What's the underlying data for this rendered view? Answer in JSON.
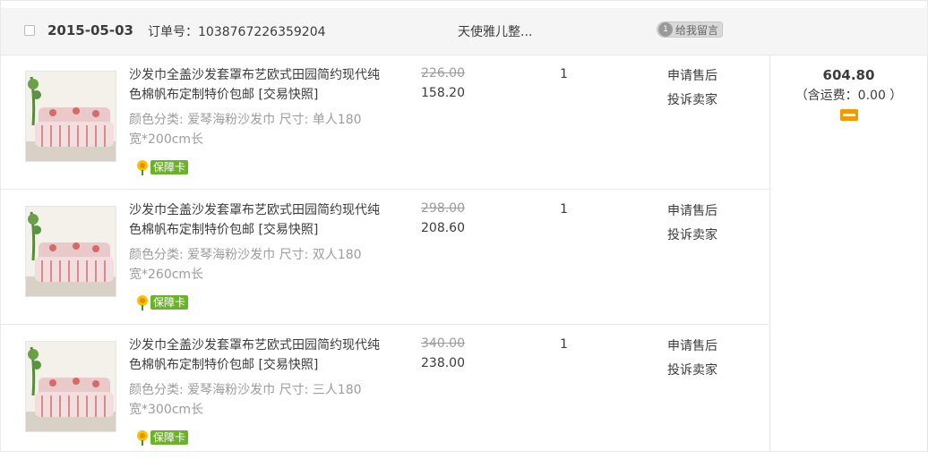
{
  "order": {
    "date": "2015-05-03",
    "order_no_label": "订单号：1038767226359204",
    "shop_name": "天使雅儿整...",
    "message_badge": "1",
    "message_label": "给我留言",
    "total": "604.80",
    "shipping_text": "（含运费：0.00 ）"
  },
  "items": [
    {
      "title": "沙发巾全盖沙发套罩布艺欧式田园简约现代纯色棉帆布定制特价包邮 [交易快照]",
      "sku": "颜色分类: 爱琴海粉沙发巾 尺寸: 单人180宽*200cm长",
      "guarantee": "保障卡",
      "price_original": "226.00",
      "price_actual": "158.20",
      "quantity": "1",
      "action_aftersale": "申请售后",
      "action_complain": "投诉卖家"
    },
    {
      "title": "沙发巾全盖沙发套罩布艺欧式田园简约现代纯色棉帆布定制特价包邮 [交易快照]",
      "sku": "颜色分类: 爱琴海粉沙发巾 尺寸: 双人180宽*260cm长",
      "guarantee": "保障卡",
      "price_original": "298.00",
      "price_actual": "208.60",
      "quantity": "1",
      "action_aftersale": "申请售后",
      "action_complain": "投诉卖家"
    },
    {
      "title": "沙发巾全盖沙发套罩布艺欧式田园简约现代纯色棉帆布定制特价包邮 [交易快照]",
      "sku": "颜色分类: 爱琴海粉沙发巾 尺寸: 三人180宽*300cm长",
      "guarantee": "保障卡",
      "price_original": "340.00",
      "price_actual": "238.00",
      "quantity": "1",
      "action_aftersale": "申请售后",
      "action_complain": "投诉卖家"
    }
  ],
  "colors": {
    "header_bg": "#f5f5f5",
    "border": "#e8e8e8",
    "guarantee_green": "#6bb22a",
    "card_orange": "#f39800"
  },
  "icons": [
    "checkbox-icon",
    "message-icon",
    "sofa-product-thumbnail",
    "guarantee-flower-icon",
    "payment-card-icon"
  ]
}
